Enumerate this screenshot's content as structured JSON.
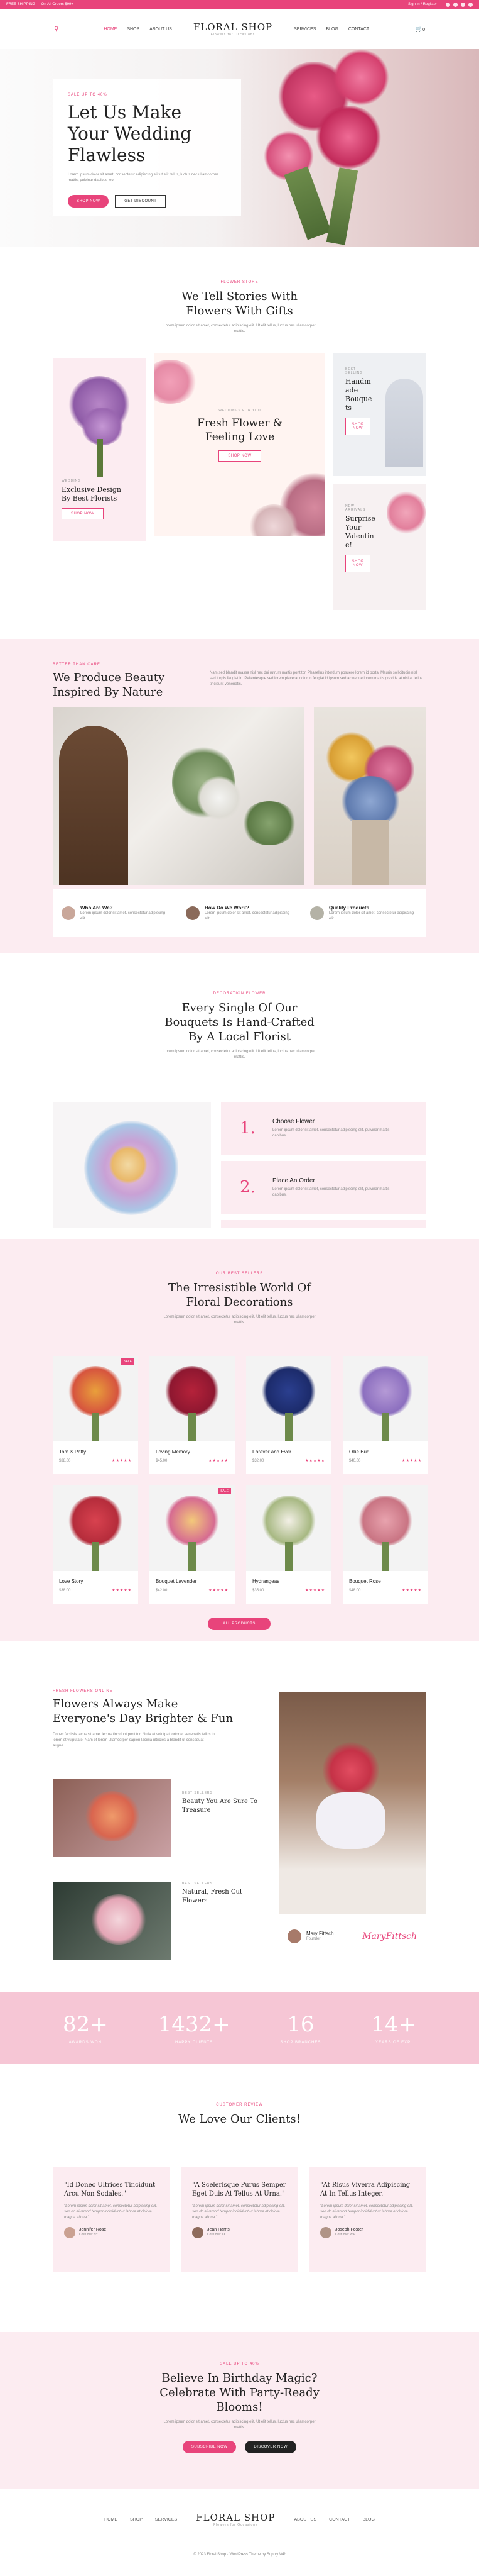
{
  "topbar": {
    "left": "FREE SHIPPING — On All Orders $99+",
    "right": "Sign In / Register"
  },
  "nav": {
    "items": [
      "HOME",
      "SHOP",
      "ABOUT US",
      "SERVICES",
      "BLOG",
      "CONTACT"
    ],
    "logo": "FLORAL SHOP",
    "logo_sub": "Flowers for Occasions",
    "cart_count": "0"
  },
  "hero": {
    "eyebrow": "SALE UP TO 40%",
    "title": "Let Us Make Your Wedding Flawless",
    "text": "Lorem ipsum dolor sit amet, consectetur adipiscing elit ut elit tellus, luctus nec ullamcorper mattis, pulvinar dapibus leo.",
    "btn1": "SHOP NOW",
    "btn2": "GET DISCOUNT"
  },
  "stories": {
    "eyebrow": "FLOWER STORE",
    "title": "We Tell Stories With Flowers With Gifts",
    "text": "Lorem ipsum dolor sit amet, consectetur adipiscing elit. Ut elit tellus, luctus nec ullamcorper mattis.",
    "card1": {
      "label": "WEDDING",
      "title": "Exclusive Design By Best Florists",
      "btn": "SHOP NOW"
    },
    "card2": {
      "label": "WEDDINGS FOR YOU",
      "title": "Fresh Flower & Feeling Love",
      "btn": "SHOP NOW"
    },
    "card3": {
      "label": "BEST SELLING",
      "title": "Handm ade Bouque ts",
      "btn": "SHOP NOW"
    },
    "card4": {
      "label": "NEW ARRIVALS",
      "title": "Surprise Your Valentin e!",
      "btn": "SHOP NOW"
    }
  },
  "beauty": {
    "eyebrow": "BETTER THAN CARE",
    "title": "We Produce Beauty Inspired By Nature",
    "text": "Nam sed blandit massa nisl nec dui rutrum mattis porttitor. Phasellus interdum posuere lorem id porta. Mauris sollicitudin nisl sed turpis feugiat in. Pellentesque sed lorem placerat dolor in feugiat id ipsum sed ac neque lorem mattis gravida at nisi at tellus tincidunt venenatis.",
    "features": [
      {
        "title": "Who Are We?",
        "text": "Lorem ipsum dolor sit amet, consectetur adipiscing elit."
      },
      {
        "title": "How Do We Work?",
        "text": "Lorem ipsum dolor sit amet, consectetur adipiscing elit."
      },
      {
        "title": "Quality Products",
        "text": "Lorem ipsum dolor sit amet, consectetur adipiscing elit."
      }
    ]
  },
  "handcraft": {
    "eyebrow": "DECORATION FLOWER",
    "title": "Every Single Of Our Bouquets Is Hand-Crafted By A Local Florist",
    "text": "Lorem ipsum dolor sit amet, consectetur adipiscing elit. Ut elit tellus, luctus nec ullamcorper mattis.",
    "steps": [
      {
        "num": "1.",
        "title": "Choose Flower",
        "text": "Lorem ipsum dolor sit amet, consectetur adipiscing elit, pulvinar mattis dapibus."
      },
      {
        "num": "2.",
        "title": "Place An Order",
        "text": "Lorem ipsum dolor sit amet, consectetur adipiscing elit, pulvinar mattis dapibus."
      }
    ]
  },
  "products": {
    "eyebrow": "OUR BEST SELLERS",
    "title": "The Irresistible World Of Floral Decorations",
    "text": "Lorem ipsum dolor sit amet, consectetur adipiscing elit. Ut elit tellus, luctus nec ullamcorper mattis.",
    "items": [
      {
        "name": "Tom & Patty",
        "price": "$38.00",
        "badge": "SALE"
      },
      {
        "name": "Loving Memory",
        "price": "$45.00",
        "badge": ""
      },
      {
        "name": "Forever and Ever",
        "price": "$32.00",
        "badge": ""
      },
      {
        "name": "Ollie Bud",
        "price": "$40.00",
        "badge": ""
      },
      {
        "name": "Love Story",
        "price": "$38.00",
        "badge": ""
      },
      {
        "name": "Bouquet Lavender",
        "price": "$42.00",
        "badge": "SALE"
      },
      {
        "name": "Hydrangeas",
        "price": "$35.00",
        "badge": ""
      },
      {
        "name": "Bouquet Rose",
        "price": "$48.00",
        "badge": ""
      }
    ],
    "btn": "ALL PRODUCTS"
  },
  "brighter": {
    "eyebrow": "FRESH FLOWERS ONLINE",
    "title": "Flowers Always Make Everyone's Day Brighter & Fun",
    "text": "Donec facilisis lacus sit amet lectus tincidunt porttitor. Nulla et volutpat tortor et venenatis tellus in lorem et vulputate. Nam et lorem ullamcorper sapien lacinia ultricies a blandit ut consequat augue.",
    "items": [
      {
        "label": "BEST SELLERS",
        "title": "Beauty You Are Sure To Treasure"
      },
      {
        "label": "BEST SELLERS",
        "title": "Natural, Fresh Cut Flowers"
      }
    ],
    "person": "Mary Fittsch",
    "role": "Founder",
    "signature": "MaryFittsch"
  },
  "stats": [
    {
      "value": "82+",
      "label": "AWARDS WON"
    },
    {
      "value": "1432+",
      "label": "HAPPY CLIENTS"
    },
    {
      "value": "16",
      "label": "SHOP BRANCHES"
    },
    {
      "value": "14+",
      "label": "YEARS OF EXP."
    }
  ],
  "testimonials": {
    "eyebrow": "CUSTOMER REVIEW",
    "title": "We Love Our Clients!",
    "items": [
      {
        "quote": "\"Id Donec Ultrices Tincidunt Arcu Non Sodales.\"",
        "text": "\"Lorem ipsum dolor sit amet, consectetur adipiscing elit, sed do eiusmod tempor incididunt ut labore et dolore magna aliqua.\"",
        "name": "Jennifer Rose",
        "role": "Costumer NY"
      },
      {
        "quote": "\"A Scelerisque Purus Semper Eget Duis At Tellus At Urna.\"",
        "text": "\"Lorem ipsum dolor sit amet, consectetur adipiscing elit, sed do eiusmod tempor incididunt ut labore et dolore magna aliqua.\"",
        "name": "Jean Harris",
        "role": "Costumer TX"
      },
      {
        "quote": "\"At Risus Viverra Adipiscing At In Tellus Integer.\"",
        "text": "\"Lorem ipsum dolor sit amet, consectetur adipiscing elit, sed do eiusmod tempor incididunt ut labore et dolore magna aliqua.\"",
        "name": "Joseph Foster",
        "role": "Costumer WA"
      }
    ]
  },
  "cta": {
    "eyebrow": "SALE UP TO 40%",
    "title": "Believe In Birthday Magic? Celebrate With Party-Ready Blooms!",
    "text": "Lorem ipsum dolor sit amet, consectetur adipiscing elit. Ut elit tellus, luctus nec ullamcorper mattis.",
    "btn1": "SUBSCRIBE NOW",
    "btn2": "DISCOVER NOW"
  },
  "footer": {
    "links": [
      "HOME",
      "SHOP",
      "SERVICES",
      "ABOUT US",
      "CONTACT",
      "BLOG"
    ],
    "copyright": "© 2023 Floral Shop · WordPress Theme by Supply WP"
  },
  "colors": {
    "accent": "#e8447b",
    "pink_bg": "#fcecf1"
  }
}
